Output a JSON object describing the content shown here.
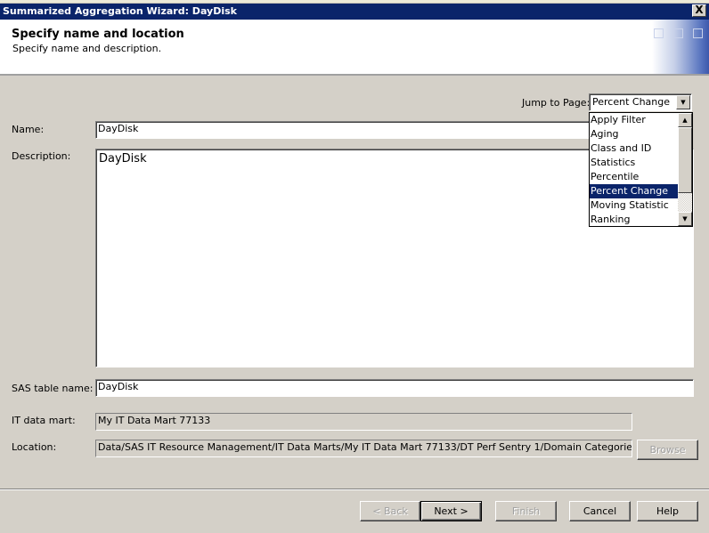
{
  "window": {
    "title": "Summarized Aggregation Wizard: DayDisk",
    "close_symbol": "X"
  },
  "header": {
    "title": "Specify name and location",
    "subtitle": "Specify name and description."
  },
  "jump": {
    "label": "Jump to Page:",
    "selected": "Percent Change",
    "arrow": "▼",
    "options": [
      "Apply Filter",
      "Aging",
      "Class and ID",
      "Statistics",
      "Percentile",
      "Percent Change",
      "Moving Statistic",
      "Ranking"
    ],
    "scroll_up": "▲",
    "scroll_down": "▼"
  },
  "form": {
    "name_label": "Name:",
    "name_value": "DayDisk",
    "description_label": "Description:",
    "description_value": "DayDisk",
    "table_label": "SAS table name:",
    "table_value": "DayDisk",
    "mart_label": "IT data mart:",
    "mart_value": "My IT Data Mart 77133",
    "location_label": "Location:",
    "location_value": "Data/SAS IT Resource Management/IT Data Marts/My IT Data Mart 77133/DT Perf Sentry 1/Domain Categories/Server Disk",
    "browse_label": "Browse"
  },
  "buttons": {
    "back": "< Back",
    "next": "Next >",
    "finish": "Finish",
    "cancel": "Cancel",
    "help": "Help"
  }
}
